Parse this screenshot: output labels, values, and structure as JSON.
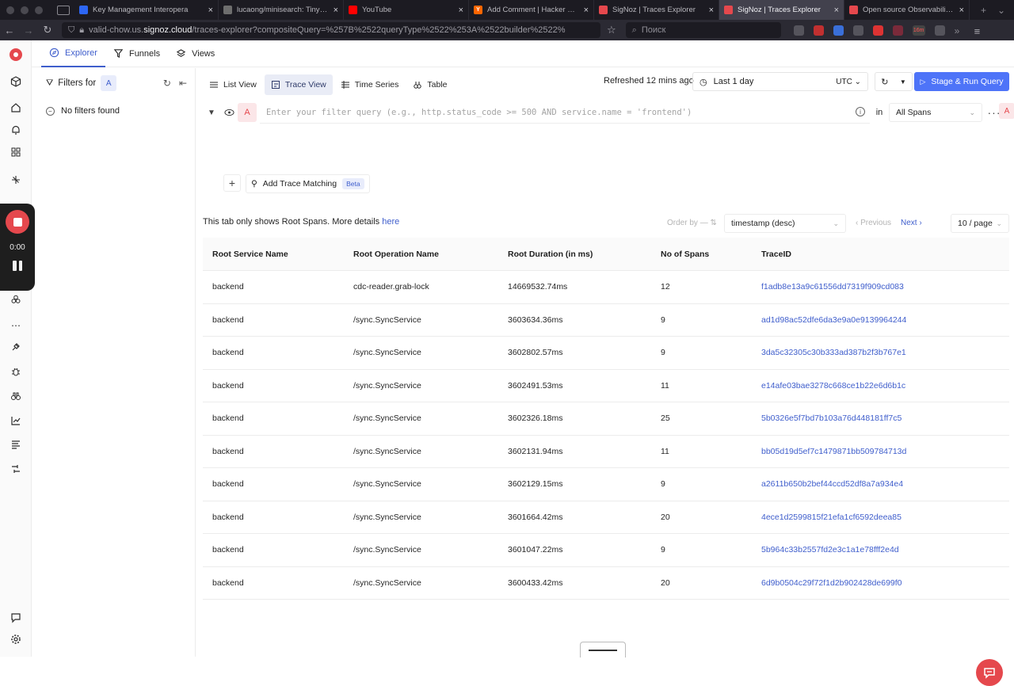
{
  "browser": {
    "tabs": [
      {
        "label": "Key Management Interopera",
        "color": "#2d66f4",
        "glyph": ""
      },
      {
        "label": "lucaong/minisearch: Tiny an",
        "color": "#6e6e6e",
        "glyph": ""
      },
      {
        "label": "YouTube",
        "color": "#ff0000",
        "glyph": ""
      },
      {
        "label": "Add Comment | Hacker News",
        "color": "#ff6600",
        "glyph": "Y"
      },
      {
        "label": "SigNoz | Traces Explorer",
        "color": "#e5484d",
        "glyph": ""
      },
      {
        "label": "SigNoz | Traces Explorer",
        "color": "#e5484d",
        "glyph": ""
      },
      {
        "label": "Open source Observability P",
        "color": "#e5484d",
        "glyph": ""
      }
    ],
    "active_tab_index": 5,
    "url_prefix": "valid-chow.us.",
    "url_host": "signoz.cloud",
    "url_rest": "/traces-explorer?compositeQuery=%257B%2522queryType%2522%253A%2522builder%2522%",
    "search_placeholder": "Поиск",
    "ext_badge": "16m"
  },
  "recorder": {
    "time": "0:00"
  },
  "header": {
    "tabs": [
      {
        "label": "Explorer",
        "icon": "compass-icon"
      },
      {
        "label": "Funnels",
        "icon": "funnel-icon"
      },
      {
        "label": "Views",
        "icon": "views-icon"
      }
    ]
  },
  "filters": {
    "title": "Filters for",
    "query_letter": "A",
    "empty_text": "No filters found"
  },
  "toolbar": {
    "views": [
      "List View",
      "Trace View",
      "Time Series",
      "Table"
    ],
    "active_view": 1,
    "refreshed": "Refreshed 12 mins ago",
    "time_range": "Last 1 day",
    "timezone": "UTC",
    "run_label": "Stage & Run Query"
  },
  "query": {
    "letter": "A",
    "placeholder": "Enter your filter query (e.g., http.status_code >= 500 AND service.name = 'frontend')",
    "in_label": "in",
    "span_scope": "All Spans",
    "add_trace_matching": "Add Trace Matching",
    "beta": "Beta"
  },
  "results": {
    "info": "This tab only shows Root Spans. More details",
    "info_link": "here",
    "order_by_label": "Order by",
    "order_by_sep": "—",
    "order_value": "timestamp (desc)",
    "prev": "Previous",
    "next": "Next",
    "per_page": "10 / page",
    "columns": [
      "Root Service Name",
      "Root Operation Name",
      "Root Duration (in ms)",
      "No of Spans",
      "TraceID"
    ],
    "rows": [
      [
        "backend",
        "cdc-reader.grab-lock",
        "14669532.74ms",
        "12",
        "f1adb8e13a9c61556dd7319f909cd083"
      ],
      [
        "backend",
        "/sync.SyncService",
        "3603634.36ms",
        "9",
        "ad1d98ac52dfe6da3e9a0e9139964244"
      ],
      [
        "backend",
        "/sync.SyncService",
        "3602802.57ms",
        "9",
        "3da5c32305c30b333ad387b2f3b767e1"
      ],
      [
        "backend",
        "/sync.SyncService",
        "3602491.53ms",
        "11",
        "e14afe03bae3278c668ce1b22e6d6b1c"
      ],
      [
        "backend",
        "/sync.SyncService",
        "3602326.18ms",
        "25",
        "5b0326e5f7bd7b103a76d448181ff7c5"
      ],
      [
        "backend",
        "/sync.SyncService",
        "3602131.94ms",
        "11",
        "bb05d19d5ef7c1479871bb509784713d"
      ],
      [
        "backend",
        "/sync.SyncService",
        "3602129.15ms",
        "9",
        "a2611b650b2bef44ccd52df8a7a934e4"
      ],
      [
        "backend",
        "/sync.SyncService",
        "3601664.42ms",
        "20",
        "4ece1d2599815f21efa1cf6592deea85"
      ],
      [
        "backend",
        "/sync.SyncService",
        "3601047.22ms",
        "9",
        "5b964c33b2557fd2e3c1a1e78fff2e4d"
      ],
      [
        "backend",
        "/sync.SyncService",
        "3600433.42ms",
        "20",
        "6d9b0504c29f72f1d2b902428de699f0"
      ]
    ]
  },
  "colors": {
    "accent": "#4e74f8",
    "brand": "#e5484d",
    "link": "#3f5ecc"
  }
}
